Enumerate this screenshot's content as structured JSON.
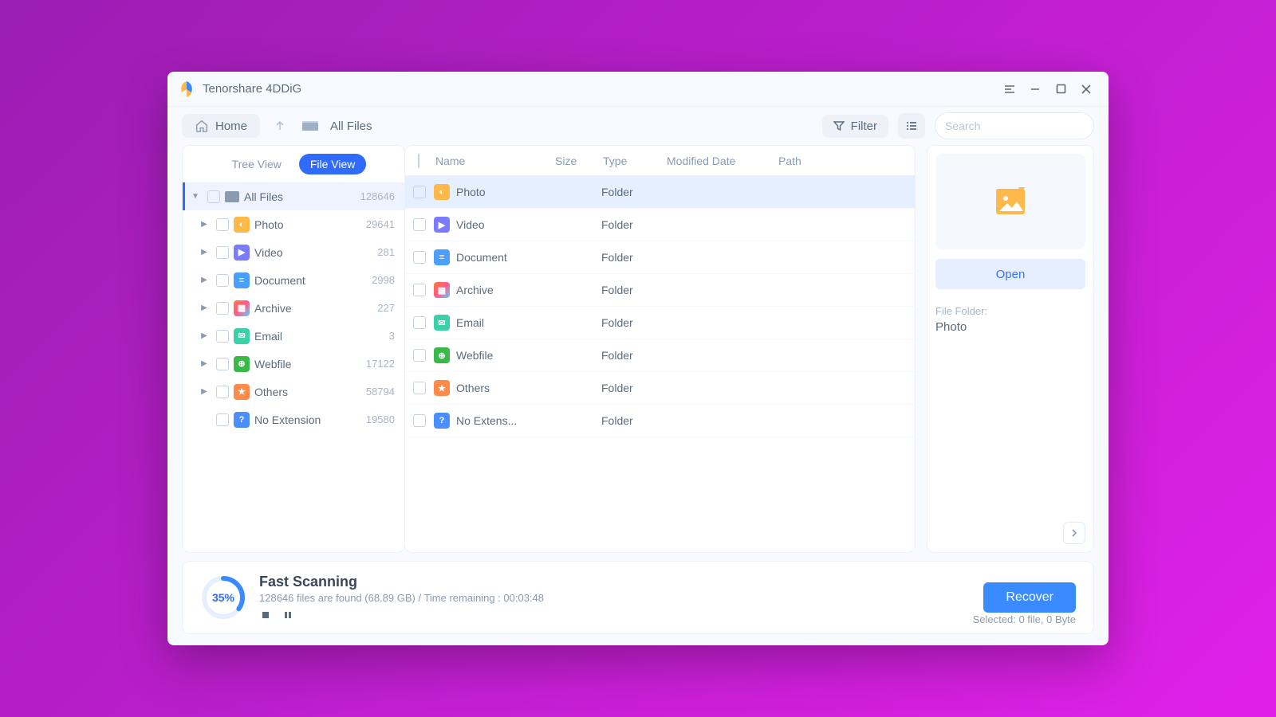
{
  "titlebar": {
    "app_name": "Tenorshare 4DDiG"
  },
  "toolbar": {
    "home": "Home",
    "breadcrumb": "All Files",
    "filter": "Filter",
    "search_placeholder": "Search"
  },
  "sidebar": {
    "tabs": {
      "tree": "Tree View",
      "file": "File View"
    },
    "root": {
      "label": "All Files",
      "count": "128646"
    },
    "items": [
      {
        "label": "Photo",
        "count": "29641",
        "icon": "photo"
      },
      {
        "label": "Video",
        "count": "281",
        "icon": "video"
      },
      {
        "label": "Document",
        "count": "2998",
        "icon": "doc"
      },
      {
        "label": "Archive",
        "count": "227",
        "icon": "archive"
      },
      {
        "label": "Email",
        "count": "3",
        "icon": "email"
      },
      {
        "label": "Webfile",
        "count": "17122",
        "icon": "web"
      },
      {
        "label": "Others",
        "count": "58794",
        "icon": "other"
      },
      {
        "label": "No Extension",
        "count": "19580",
        "icon": "noext"
      }
    ]
  },
  "columns": {
    "name": "Name",
    "size": "Size",
    "type": "Type",
    "modified": "Modified Date",
    "path": "Path"
  },
  "files": [
    {
      "name": "Photo",
      "type": "Folder",
      "icon": "photo"
    },
    {
      "name": "Video",
      "type": "Folder",
      "icon": "video"
    },
    {
      "name": "Document",
      "type": "Folder",
      "icon": "doc"
    },
    {
      "name": "Archive",
      "type": "Folder",
      "icon": "archive"
    },
    {
      "name": "Email",
      "type": "Folder",
      "icon": "email"
    },
    {
      "name": "Webfile",
      "type": "Folder",
      "icon": "web"
    },
    {
      "name": "Others",
      "type": "Folder",
      "icon": "other"
    },
    {
      "name": "No Extens...",
      "type": "Folder",
      "icon": "noext"
    }
  ],
  "detail": {
    "open": "Open",
    "folder_label": "File Folder:",
    "folder_value": "Photo"
  },
  "footer": {
    "progress_pct": "35%",
    "progress_value": 35,
    "title": "Fast Scanning",
    "subtitle": "128646 files are found (68.89 GB) /  Time remaining : 00:03:48",
    "recover": "Recover",
    "selected": "Selected: 0 file, 0 Byte"
  }
}
